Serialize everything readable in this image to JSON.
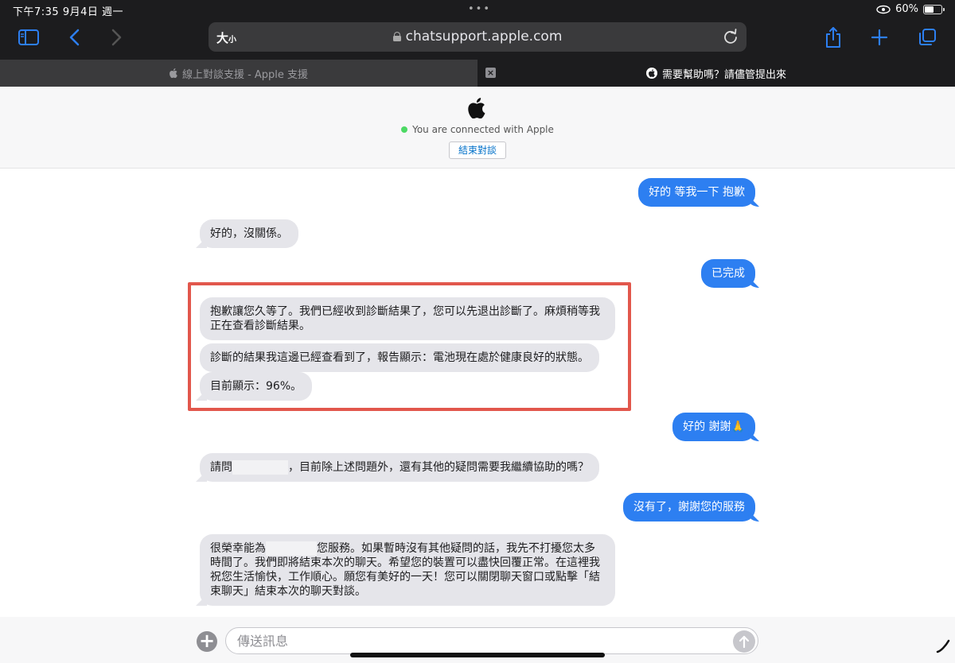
{
  "status_bar": {
    "time_date": "下午7:35   9月4日 週一",
    "dots": "•••",
    "battery_text": "60%",
    "battery_level": 0.6
  },
  "toolbar": {
    "text_size_label": "大",
    "text_size_small": "小",
    "url": "chatsupport.apple.com"
  },
  "tabs": [
    {
      "label": "線上對談支援 - Apple 支援",
      "active": false
    },
    {
      "label": "需要幫助嗎？請儘管提出來",
      "active": true,
      "close_label": "×"
    }
  ],
  "chat_header": {
    "status": "You are connected with Apple",
    "end_button": "結束對談"
  },
  "messages": [
    {
      "from": "user",
      "text": "好的 等我一下 抱歉"
    },
    {
      "from": "agent",
      "text": "好的，沒關係。"
    },
    {
      "from": "user",
      "text": "已完成"
    },
    {
      "from": "agent",
      "text": "抱歉讓您久等了。我們已經收到診斷結果了，您可以先退出診斷了。麻煩稍等我正在查看診斷結果。"
    },
    {
      "from": "agent",
      "text": "診斷的結果我這邊已經查看到了，報告顯示：電池現在處於健康良好的狀態。"
    },
    {
      "from": "agent",
      "text": "目前顯示：96%。"
    },
    {
      "from": "user",
      "text": "好的 謝謝🙏"
    },
    {
      "from": "agent",
      "text_before": "請問",
      "text_after": "，目前除上述問題外，還有其他的疑問需要我繼續協助的嗎？"
    },
    {
      "from": "user",
      "text": "沒有了，謝謝您的服務"
    },
    {
      "from": "agent",
      "text_before": "很榮幸能為",
      "text_after": "您服務。如果暫時沒有其他疑問的話，我先不打擾您太多時間了。我們即將結束本次的聊天。希望您的裝置可以盡快回覆正常。在這裡我祝您生活愉快，工作順心。願您有美好的一天！您可以關閉聊天窗口或點擊「結束聊天」結束本次的聊天對談。"
    }
  ],
  "composer": {
    "placeholder": "傳送訊息",
    "plus_label": "+"
  },
  "colors": {
    "user_bubble": "#2d7ff1",
    "agent_bubble": "#e5e5ea",
    "highlight": "#e2574c",
    "connected_dot": "#4cd964"
  }
}
